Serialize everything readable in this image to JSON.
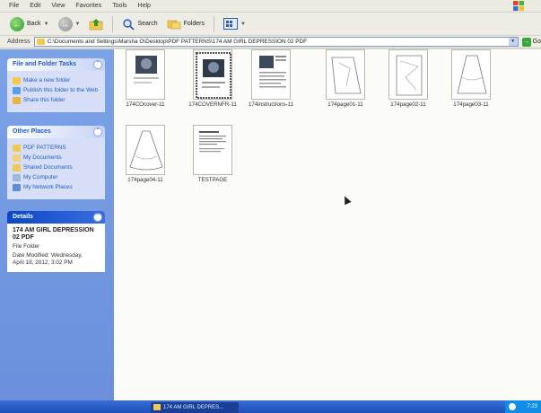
{
  "menubar": {
    "items": [
      "File",
      "Edit",
      "View",
      "Favorites",
      "Tools",
      "Help"
    ]
  },
  "toolbar": {
    "back_label": "Back",
    "search_label": "Search",
    "folders_label": "Folders"
  },
  "address": {
    "label": "Address",
    "path": "C:\\Documents and Settings\\Marsha O\\Desktop\\PDF PATTERNS\\174 AM GIRL DEPRESSION 02 PDF",
    "go_label": "Go"
  },
  "tasks_panel": {
    "title": "File and Folder Tasks",
    "items": [
      "Make a new folder",
      "Publish this folder to the Web",
      "Share this folder"
    ]
  },
  "places_panel": {
    "title": "Other Places",
    "items": [
      "PDF PATTERNS",
      "My Documents",
      "Shared Documents",
      "My Computer",
      "My Network Places"
    ]
  },
  "details_panel": {
    "title": "Details",
    "name": "174 AM GIRL DEPRESSION 02 PDF",
    "type": "File Folder",
    "modified_line1": "Date Modified: Wednesday,",
    "modified_line2": "April 18, 2012, 3:02 PM"
  },
  "files": [
    {
      "name": "174COcover-11",
      "icon": "cover-thumb-icon"
    },
    {
      "name": "174COVERNFR-11",
      "icon": "cover-thumb-icon"
    },
    {
      "name": "174instructions-11",
      "icon": "document-thumb-icon"
    },
    {
      "name": "174page01-11",
      "icon": "pattern-thumb-icon"
    },
    {
      "name": "174page02-11",
      "icon": "pattern-thumb-icon"
    },
    {
      "name": "174page03-11",
      "icon": "pattern-thumb-icon"
    },
    {
      "name": "174page04-11",
      "icon": "pattern-thumb-icon"
    },
    {
      "name": "TESTPAGE",
      "icon": "document-thumb-icon"
    }
  ],
  "taskbar": {
    "window_label": "174 AM GIRL DEPRES...",
    "clock": "7:23"
  },
  "colors": {
    "sidebar": "#6b8fdc",
    "panel_link": "#215dc6",
    "taskbar": "#1d4fb8"
  }
}
